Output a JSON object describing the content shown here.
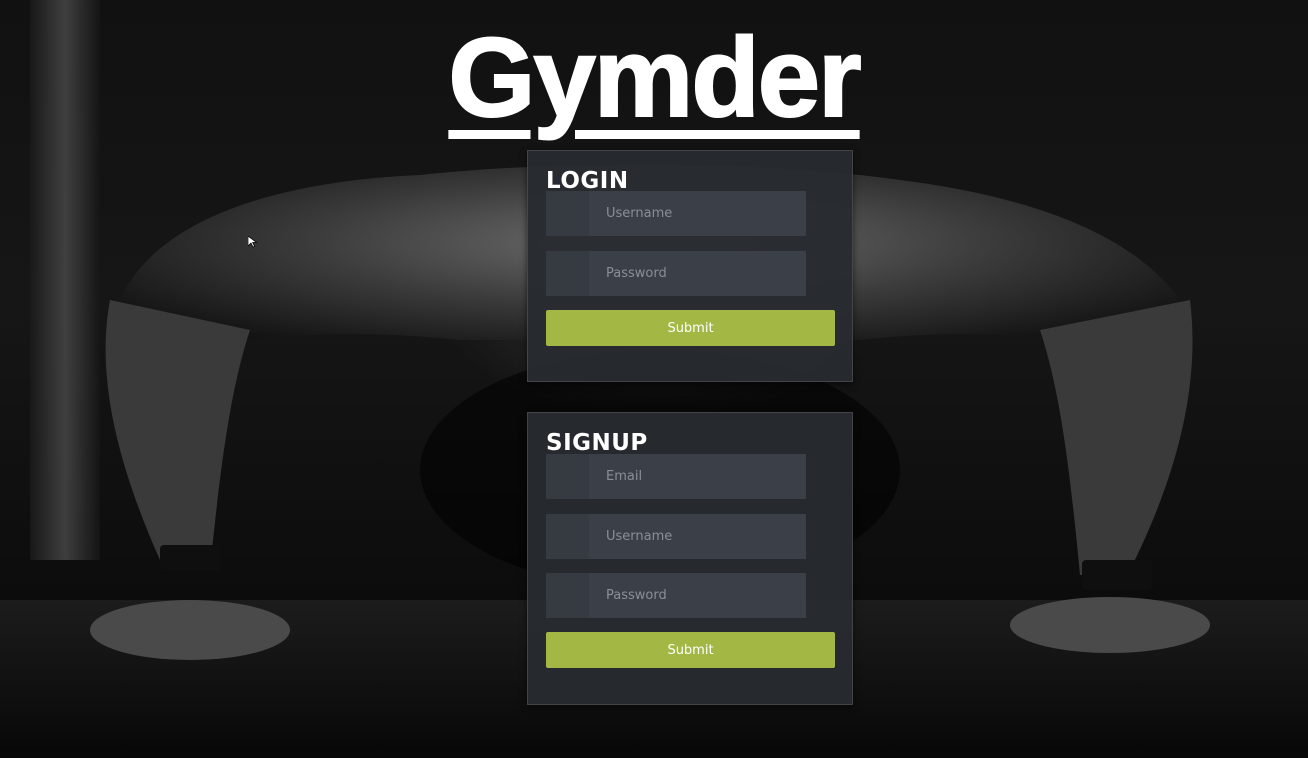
{
  "app": {
    "logo_text": "Gymder"
  },
  "login": {
    "title": "LOGIN",
    "username_placeholder": "Username",
    "password_placeholder": "Password",
    "submit_label": "Submit"
  },
  "signup": {
    "title": "SIGNUP",
    "email_placeholder": "Email",
    "username_placeholder": "Username",
    "password_placeholder": "Password",
    "submit_label": "Submit"
  },
  "theme": {
    "accent": "#a3b745",
    "panel_bg": "#282b30",
    "input_bg": "#3b3f47",
    "background": "#0b0b0b"
  },
  "icons": {
    "username_field": "user-icon",
    "password_field": "lock-icon",
    "email_field": "email-icon",
    "cursor": "mouse-pointer-icon"
  }
}
